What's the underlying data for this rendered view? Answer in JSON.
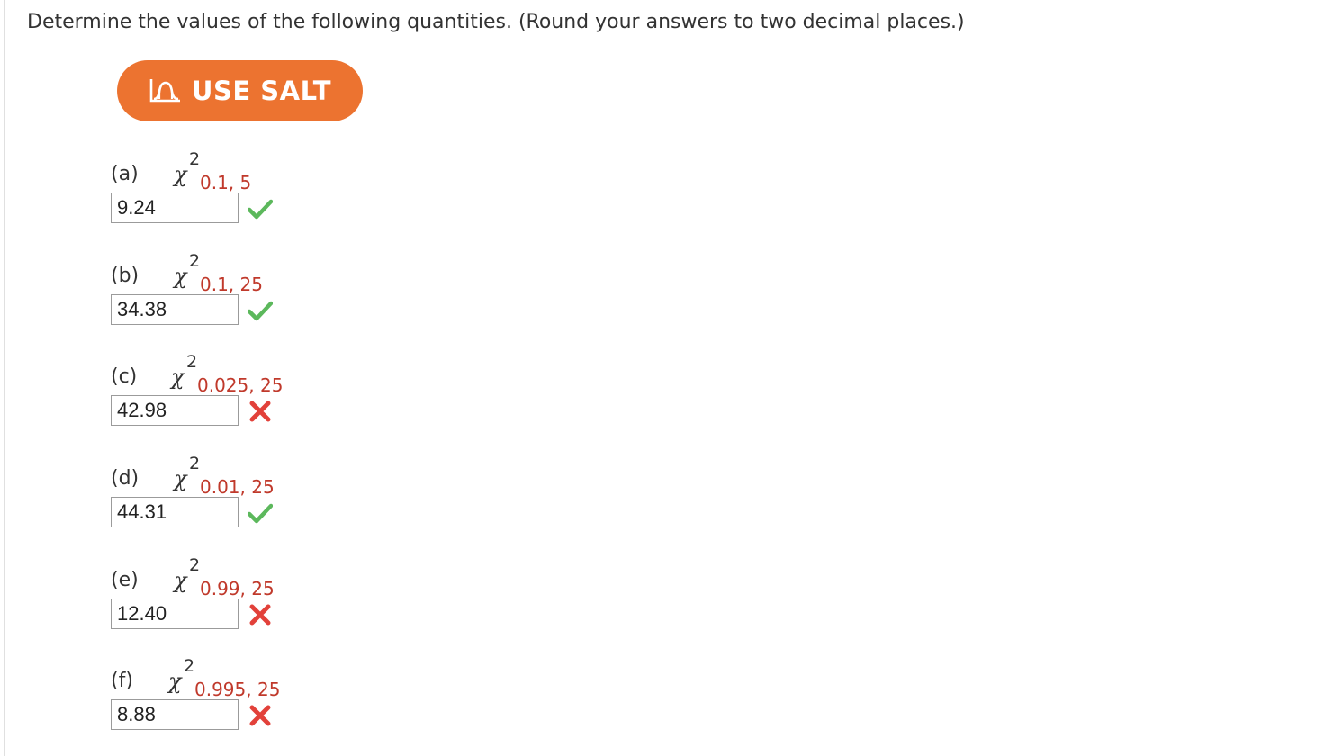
{
  "question": {
    "text": "Determine the values of the following quantities. (Round your answers to two decimal places.)"
  },
  "salt_button": {
    "label": "USE SALT",
    "icon": "salt-icon",
    "color": "#ec7330"
  },
  "status_colors": {
    "correct": "#5cb85c",
    "incorrect": "#e2413a",
    "subscript": "#c0392b"
  },
  "parts": [
    {
      "label": "(a)",
      "symbol": "χ",
      "sup": "2",
      "sub": "0.1, 5",
      "answer": "9.24",
      "status": "correct",
      "status_icon": "checkmark-icon"
    },
    {
      "label": "(b)",
      "symbol": "χ",
      "sup": "2",
      "sub": "0.1, 25",
      "answer": "34.38",
      "status": "correct",
      "status_icon": "checkmark-icon"
    },
    {
      "label": "(c)",
      "symbol": "χ",
      "sup": "2",
      "sub": "0.025, 25",
      "answer": "42.98",
      "status": "incorrect",
      "status_icon": "x-mark-icon"
    },
    {
      "label": "(d)",
      "symbol": "χ",
      "sup": "2",
      "sub": "0.01, 25",
      "answer": "44.31",
      "status": "correct",
      "status_icon": "checkmark-icon"
    },
    {
      "label": "(e)",
      "symbol": "χ",
      "sup": "2",
      "sub": "0.99, 25",
      "answer": "12.40",
      "status": "incorrect",
      "status_icon": "x-mark-icon"
    },
    {
      "label": "(f)",
      "symbol": "χ",
      "sup": "2",
      "sub": "0.995, 25",
      "answer": "8.88",
      "status": "incorrect",
      "status_icon": "x-mark-icon"
    }
  ]
}
